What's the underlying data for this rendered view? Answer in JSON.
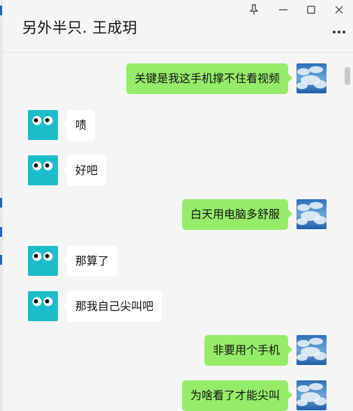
{
  "window": {
    "title": "另外半只. 王成玥",
    "controls": {
      "pin_icon": "pin-icon",
      "minimize_icon": "minimize-icon",
      "maximize_icon": "maximize-icon",
      "close_icon": "close-icon",
      "more_icon": "more-icon"
    }
  },
  "colors": {
    "my_bubble": "#95ec69",
    "other_bubble": "#ffffff",
    "other_avatar": "#1bbdc8",
    "background": "#f5f5f5"
  },
  "messages": [
    {
      "sender": "me",
      "text": "关键是我这手机撑不住看视频"
    },
    {
      "sender": "other",
      "text": "啧"
    },
    {
      "sender": "other",
      "text": "好吧"
    },
    {
      "sender": "me",
      "text": "白天用电脑多舒服"
    },
    {
      "sender": "other",
      "text": "那算了"
    },
    {
      "sender": "other",
      "text": "那我自己尖叫吧"
    },
    {
      "sender": "me",
      "text": "非要用个手机"
    },
    {
      "sender": "me",
      "text": "为啥看了才能尖叫"
    }
  ]
}
